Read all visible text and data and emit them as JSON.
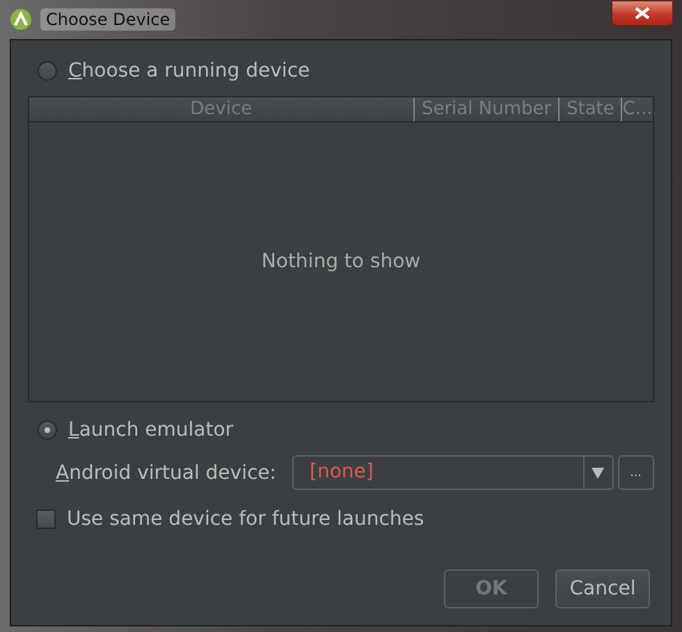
{
  "window": {
    "title": "Choose Device"
  },
  "options": [
    {
      "label": "Choose a running device",
      "selected": false
    },
    {
      "label": "Launch emulator",
      "selected": true
    }
  ],
  "table": {
    "columns": [
      "Device",
      "Serial Number",
      "State",
      "C..."
    ],
    "empty_text": "Nothing to show"
  },
  "avd": {
    "label": "Android virtual device:",
    "value": "[none]",
    "ellipsis": "..."
  },
  "same_device": {
    "label": "Use same device for future launches",
    "checked": false
  },
  "buttons": [
    {
      "label": "OK",
      "disabled": true
    },
    {
      "label": "Cancel",
      "disabled": false
    }
  ]
}
